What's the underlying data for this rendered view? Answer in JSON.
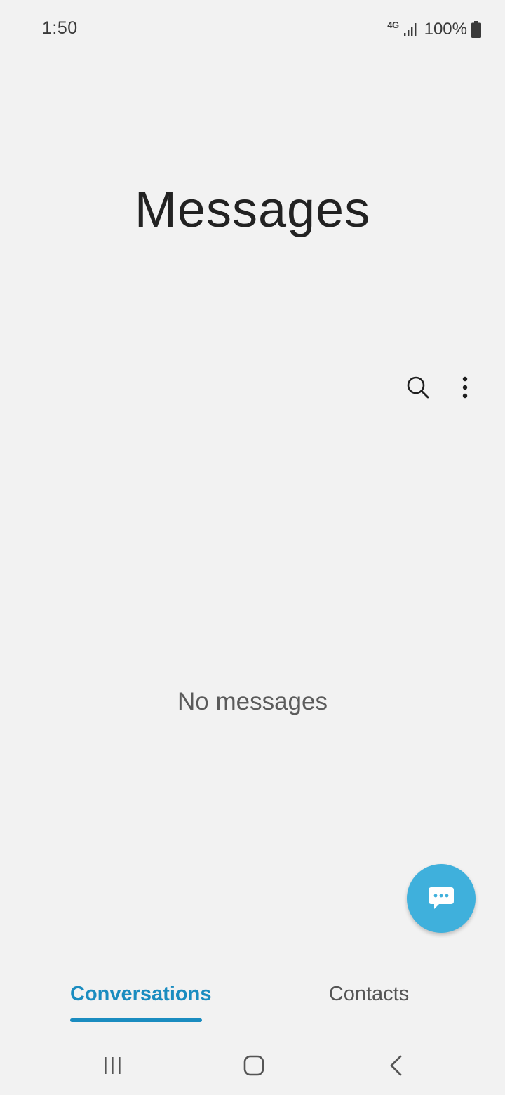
{
  "status_bar": {
    "time": "1:50",
    "network": "4G",
    "battery": "100%"
  },
  "app": {
    "title": "Messages"
  },
  "toolbar": {
    "search_icon": "search-icon",
    "more_icon": "more-vertical-icon"
  },
  "empty_state": {
    "text": "No messages"
  },
  "fab": {
    "icon": "compose-chat-icon",
    "color": "#3fb0dc"
  },
  "tabs": [
    {
      "label": "Conversations",
      "selected": true
    },
    {
      "label": "Contacts",
      "selected": false
    }
  ],
  "colors": {
    "accent": "#1a8cc0",
    "background": "#f2f2f2"
  },
  "navbar": {
    "recents_icon": "recents-icon",
    "home_icon": "home-icon",
    "back_icon": "back-icon"
  }
}
